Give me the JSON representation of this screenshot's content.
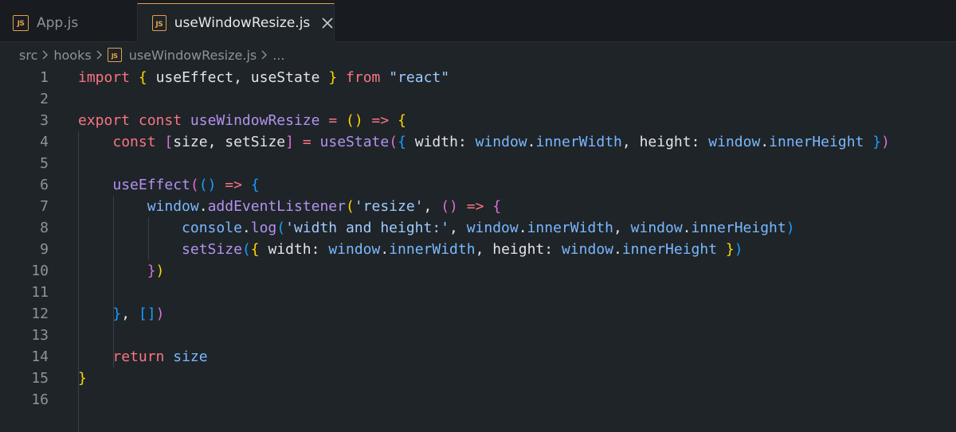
{
  "tabs": [
    {
      "icon": "JS",
      "label": "App.js"
    },
    {
      "icon": "JS",
      "label": "useWindowResize.js"
    }
  ],
  "breadcrumb": {
    "items": [
      "src",
      "hooks"
    ],
    "file_icon": "JS",
    "file": "useWindowResize.js",
    "ellipsis": "..."
  },
  "editor": {
    "line_numbers": [
      "1",
      "2",
      "3",
      "4",
      "5",
      "6",
      "7",
      "8",
      "9",
      "10",
      "11",
      "12",
      "13",
      "14",
      "15",
      "16"
    ],
    "lines": [
      "import { useEffect, useState } from \"react\"",
      "",
      "export const useWindowResize = () => {",
      "    const [size, setSize] = useState({ width: window.innerWidth, height: window.innerHeight })",
      "",
      "    useEffect(() => {",
      "        window.addEventListener('resize', () => {",
      "            console.log('width and height:', window.innerWidth, window.innerHeight)",
      "            setSize({ width: window.innerWidth, height: window.innerHeight })",
      "        })",
      "",
      "    }, [])",
      "",
      "    return size",
      "}",
      ""
    ]
  },
  "colors": {
    "background": "#1f2428",
    "tab_bar": "#181c21",
    "active_tab_accent": "#e5a04a",
    "keyword": "#f97583",
    "function": "#b392f0",
    "property": "#79b8ff",
    "string": "#9ecbff",
    "bracket_level_1": "#ffd700",
    "bracket_level_2": "#da70d6",
    "bracket_level_3": "#179fff"
  }
}
